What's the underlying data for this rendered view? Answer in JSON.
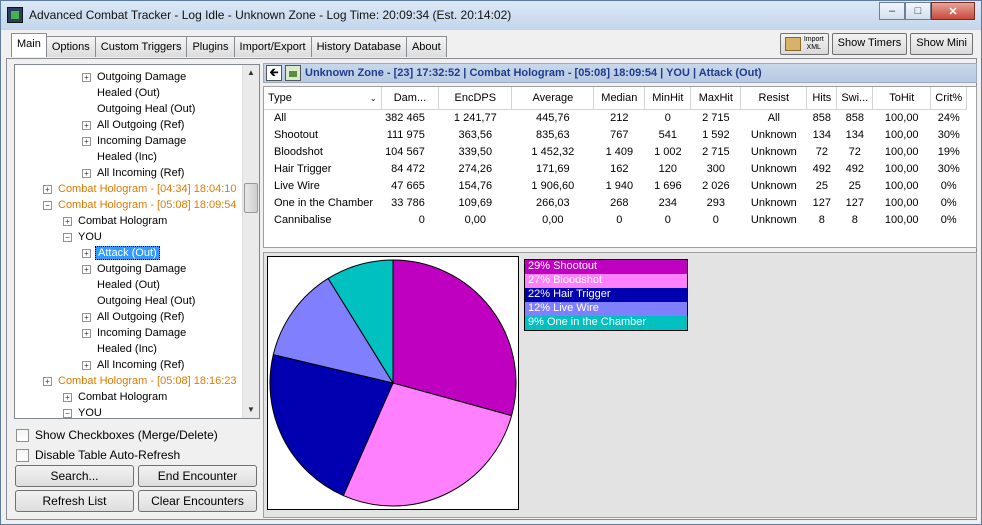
{
  "window": {
    "title": "Advanced Combat Tracker - Log Idle - Unknown Zone - Log Time: 20:09:34 (Est. 20:14:02)",
    "minimize": "–",
    "maximize": "□",
    "close": "✕"
  },
  "tabs": [
    "Main",
    "Options",
    "Custom Triggers",
    "Plugins",
    "Import/Export",
    "History Database",
    "About"
  ],
  "toolbar": {
    "import_label_1": "Import",
    "import_label_2": "XML",
    "show_timers": "Show Timers",
    "show_mini": "Show Mini"
  },
  "tree": [
    {
      "label": "Outgoing Damage",
      "exp": "+",
      "indent": 3
    },
    {
      "label": "Healed (Out)",
      "exp": "",
      "indent": 3
    },
    {
      "label": "Outgoing Heal (Out)",
      "exp": "",
      "indent": 3
    },
    {
      "label": "All Outgoing (Ref)",
      "exp": "+",
      "indent": 3
    },
    {
      "label": "Incoming Damage",
      "exp": "+",
      "indent": 3
    },
    {
      "label": "Healed (Inc)",
      "exp": "",
      "indent": 3
    },
    {
      "label": "All Incoming (Ref)",
      "exp": "+",
      "indent": 3
    },
    {
      "label": "Combat Hologram - [04:34] 18:04:10",
      "exp": "+",
      "indent": 1,
      "orange": true
    },
    {
      "label": "Combat Hologram - [05:08] 18:09:54",
      "exp": "−",
      "indent": 1,
      "orange": true
    },
    {
      "label": "Combat Hologram",
      "exp": "+",
      "indent": 2
    },
    {
      "label": "YOU",
      "exp": "−",
      "indent": 2
    },
    {
      "label": "Attack (Out)",
      "exp": "+",
      "indent": 3,
      "selected": true
    },
    {
      "label": "Outgoing Damage",
      "exp": "+",
      "indent": 3
    },
    {
      "label": "Healed (Out)",
      "exp": "",
      "indent": 3
    },
    {
      "label": "Outgoing Heal (Out)",
      "exp": "",
      "indent": 3
    },
    {
      "label": "All Outgoing (Ref)",
      "exp": "+",
      "indent": 3
    },
    {
      "label": "Incoming Damage",
      "exp": "+",
      "indent": 3
    },
    {
      "label": "Healed (Inc)",
      "exp": "",
      "indent": 3
    },
    {
      "label": "All Incoming (Ref)",
      "exp": "+",
      "indent": 3
    },
    {
      "label": "Combat Hologram - [05:08] 18:16:23",
      "exp": "+",
      "indent": 1,
      "orange": true
    },
    {
      "label": "Combat Hologram",
      "exp": "+",
      "indent": 2
    },
    {
      "label": "YOU",
      "exp": "−",
      "indent": 2
    }
  ],
  "options": {
    "show_checkboxes": "Show Checkboxes (Merge/Delete)",
    "disable_refresh": "Disable Table Auto-Refresh"
  },
  "buttons": {
    "search": "Search...",
    "end_encounter": "End Encounter",
    "refresh_list": "Refresh List",
    "clear_encounters": "Clear Encounters"
  },
  "encounter": {
    "title": "Unknown Zone - [23] 17:32:52 | Combat Hologram - [05:08] 18:09:54 | YOU | Attack (Out)",
    "back": "🡰"
  },
  "table": {
    "columns": [
      "Type",
      "Dam...",
      "EncDPS",
      "Average",
      "Median",
      "MinHit",
      "MaxHit",
      "Resist",
      "Hits",
      "Swi...",
      "ToHit",
      "Crit%"
    ],
    "sort_indicator": "⌄",
    "rows": [
      [
        "All",
        "382 465",
        "1 241,77",
        "445,76",
        "212",
        "0",
        "2 715",
        "All",
        "858",
        "858",
        "100,00",
        "24%"
      ],
      [
        "Shootout",
        "111 975",
        "363,56",
        "835,63",
        "767",
        "541",
        "1 592",
        "Unknown",
        "134",
        "134",
        "100,00",
        "30%"
      ],
      [
        "Bloodshot",
        "104 567",
        "339,50",
        "1 452,32",
        "1 409",
        "1 002",
        "2 715",
        "Unknown",
        "72",
        "72",
        "100,00",
        "19%"
      ],
      [
        "Hair Trigger",
        "84 472",
        "274,26",
        "171,69",
        "162",
        "120",
        "300",
        "Unknown",
        "492",
        "492",
        "100,00",
        "30%"
      ],
      [
        "Live Wire",
        "47 665",
        "154,76",
        "1 906,60",
        "1 940",
        "1 696",
        "2 026",
        "Unknown",
        "25",
        "25",
        "100,00",
        "0%"
      ],
      [
        "One in the Chamber",
        "33 786",
        "109,69",
        "266,03",
        "268",
        "234",
        "293",
        "Unknown",
        "127",
        "127",
        "100,00",
        "0%"
      ],
      [
        "Cannibalise",
        "0",
        "0,00",
        "0,00",
        "0",
        "0",
        "0",
        "Unknown",
        "8",
        "8",
        "100,00",
        "0%"
      ]
    ]
  },
  "chart_data": {
    "type": "pie",
    "slices": [
      {
        "label": "29% Shootout",
        "value": 111975,
        "color": "#c000c0"
      },
      {
        "label": "27% Bloodshot",
        "value": 104567,
        "color": "#ff80ff"
      },
      {
        "label": "22% Hair Trigger",
        "value": 84472,
        "color": "#0000b0"
      },
      {
        "label": "12% Live Wire",
        "value": 47665,
        "color": "#8080ff"
      },
      {
        "label": "9%   One in the Chamber",
        "value": 33786,
        "color": "#00c0c0"
      }
    ]
  }
}
